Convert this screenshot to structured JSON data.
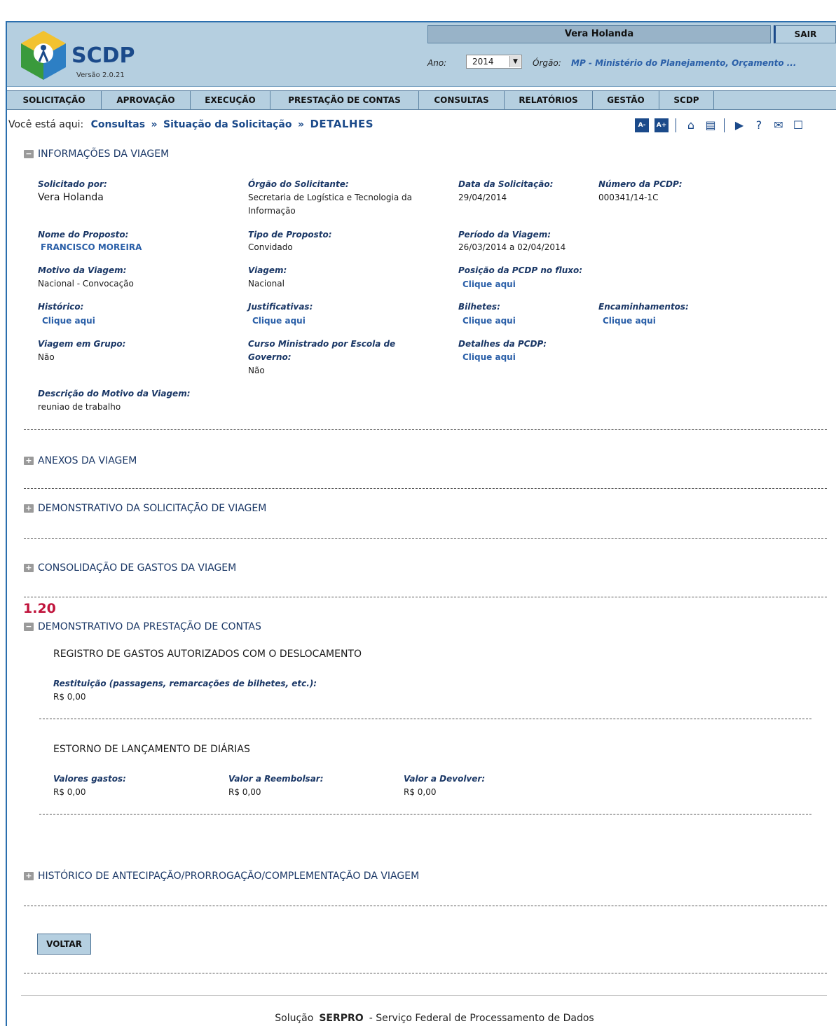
{
  "header": {
    "logo_text": "SCDP",
    "version": "Versão 2.0.21",
    "user_name": "Vera Holanda",
    "logout": "SAIR",
    "ano_label": "Ano:",
    "ano_value": "2014",
    "orgao_label": "Órgão:",
    "orgao_value": "MP - Ministério do Planejamento, Orçamento ..."
  },
  "menu": [
    "SOLICITAÇÃO",
    "APROVAÇÃO",
    "EXECUÇÃO",
    "PRESTAÇÃO DE CONTAS",
    "CONSULTAS",
    "RELATÓRIOS",
    "GESTÃO",
    "SCDP"
  ],
  "breadcrumb": {
    "prefix": "Você está aqui:",
    "items": [
      "Consultas",
      "Situação da Solicitação"
    ],
    "current": "DETALHES",
    "font_decrease": "A-",
    "font_increase": "A+"
  },
  "info": {
    "title": "INFORMAÇÕES DA VIAGEM",
    "solicitado_por_label": "Solicitado por:",
    "solicitado_por": "Vera Holanda",
    "orgao_solicitante_label": "Órgão do Solicitante:",
    "orgao_solicitante_1": "Secretaria de Logística e Tecnologia da",
    "orgao_solicitante_2": "Informação",
    "data_solicitacao_label": "Data da Solicitação:",
    "data_solicitacao": "29/04/2014",
    "numero_pcdp_label": "Número da PCDP:",
    "numero_pcdp": "000341/14-1C",
    "nome_proposto_label": "Nome do Proposto:",
    "nome_proposto": "FRANCISCO MOREIRA",
    "tipo_proposto_label": "Tipo de Proposto:",
    "tipo_proposto": "Convidado",
    "periodo_label": "Período da Viagem:",
    "periodo": "26/03/2014 a 02/04/2014",
    "motivo_label": "Motivo da Viagem:",
    "motivo": "Nacional - Convocação",
    "viagem_label": "Viagem:",
    "viagem": "Nacional",
    "posicao_label": "Posição da PCDP no fluxo:",
    "historico_label": "Histórico:",
    "justificativas_label": "Justificativas:",
    "bilhetes_label": "Bilhetes:",
    "encaminhamentos_label": "Encaminhamentos:",
    "grupo_label": "Viagem em Grupo:",
    "grupo": "Não",
    "curso_label_1": "Curso Ministrado por Escola de",
    "curso_label_2": "Governo:",
    "curso": "Não",
    "detalhes_label": "Detalhes da PCDP:",
    "descricao_label": "Descrição do Motivo da Viagem:",
    "descricao": "reuniao de trabalho",
    "link_text": "Clique aqui"
  },
  "sections": {
    "anexos": "ANEXOS DA VIAGEM",
    "demonstrativo_solicitacao": "DEMONSTRATIVO DA SOLICITAÇÃO DE VIAGEM",
    "consolidacao": "CONSOLIDAÇÃO DE GASTOS DA VIAGEM",
    "number": "1.20",
    "demonstrativo_prestacao": "DEMONSTRATIVO DA PRESTAÇÃO DE CONTAS",
    "historico_antecipacao": "HISTÓRICO DE ANTECIPAÇÃO/PRORROGAÇÃO/COMPLEMENTAÇÃO DA VIAGEM"
  },
  "prestacao": {
    "registro_title": "REGISTRO DE GASTOS AUTORIZADOS COM O DESLOCAMENTO",
    "restituicao_label": "Restituição (passagens, remarcações de bilhetes, etc.):",
    "restituicao": "R$ 0,00",
    "estorno_title": "ESTORNO DE LANÇAMENTO DE DIÁRIAS",
    "gastos_label": "Valores gastos:",
    "gastos": "R$ 0,00",
    "reembolsar_label": "Valor a Reembolsar:",
    "reembolsar": "R$ 0,00",
    "devolver_label": "Valor a Devolver:",
    "devolver": "R$ 0,00"
  },
  "voltar": "VOLTAR",
  "footer": {
    "prefix": "Solução",
    "brand": "SERPRO",
    "suffix": "- Serviço Federal de Processamento de Dados"
  }
}
